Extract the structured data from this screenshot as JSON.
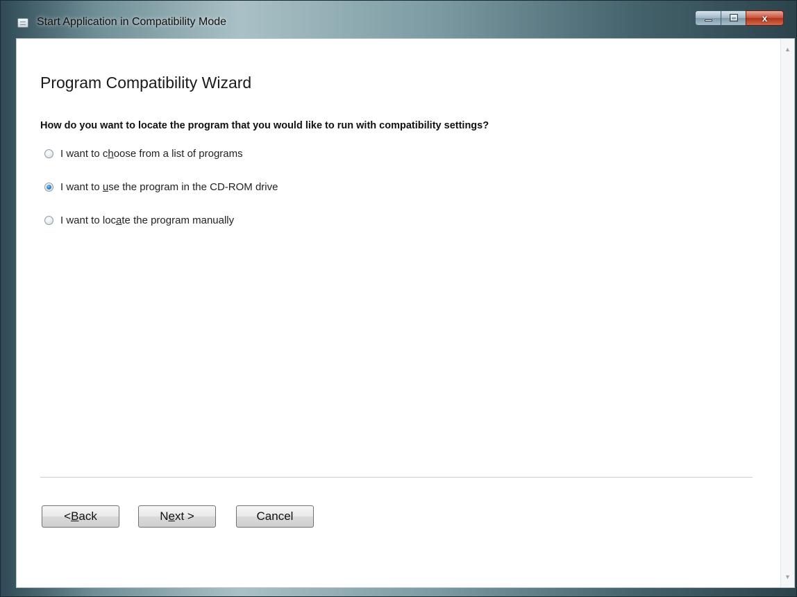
{
  "window": {
    "title": "Start Application in Compatibility Mode",
    "controls": {
      "minimize": "",
      "maximize": "",
      "close": "x"
    }
  },
  "wizard": {
    "heading": "Program Compatibility Wizard",
    "question": "How do you want to locate the program that you would like to run with compatibility settings?",
    "options": [
      {
        "pre": "I want to c",
        "access_key": "h",
        "post": "oose from a list of programs",
        "selected": false
      },
      {
        "pre": "I want to ",
        "access_key": "u",
        "post": "se the program in the CD-ROM drive",
        "selected": true
      },
      {
        "pre": "I want to loc",
        "access_key": "a",
        "post": "te the program manually",
        "selected": false
      }
    ]
  },
  "buttons": {
    "back": {
      "pre": "< ",
      "access_key": "B",
      "post": "ack"
    },
    "next": {
      "pre": "N",
      "access_key": "e",
      "post": "xt >"
    },
    "cancel": {
      "label": "Cancel"
    }
  }
}
